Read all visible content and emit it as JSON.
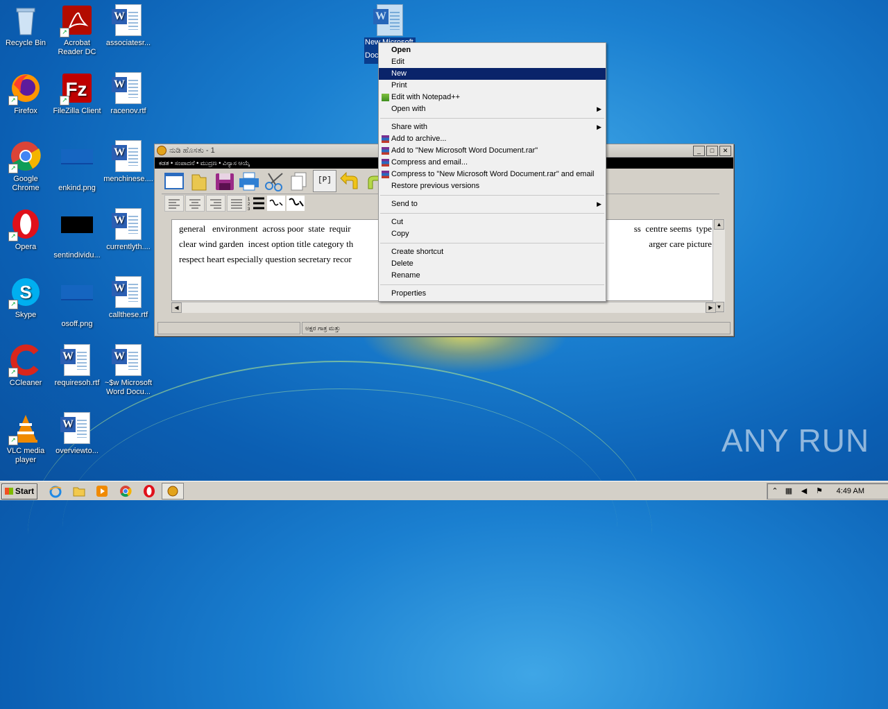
{
  "desktop": {
    "icons_col1": [
      {
        "label": "Recycle Bin",
        "icon": "recycle-bin-icon"
      },
      {
        "label": "Firefox",
        "icon": "firefox-icon"
      },
      {
        "label": "Google Chrome",
        "icon": "chrome-icon"
      },
      {
        "label": "Opera",
        "icon": "opera-icon"
      },
      {
        "label": "Skype",
        "icon": "skype-icon"
      },
      {
        "label": "CCleaner",
        "icon": "ccleaner-icon"
      },
      {
        "label": "VLC media player",
        "icon": "vlc-icon"
      }
    ],
    "icons_col2": [
      {
        "label": "Acrobat Reader DC",
        "icon": "acrobat-icon"
      },
      {
        "label": "FileZilla Client",
        "icon": "filezilla-icon"
      },
      {
        "label": "enkind.png",
        "icon": "image-file-icon"
      },
      {
        "label": "sentindividu...",
        "icon": "image-file-icon"
      },
      {
        "label": "osoff.png",
        "icon": "image-file-icon"
      },
      {
        "label": "requiresoh.rtf",
        "icon": "word-document-icon"
      },
      {
        "label": "overviewto...",
        "icon": "word-document-icon"
      }
    ],
    "icons_col3": [
      {
        "label": "associatesr...",
        "icon": "word-document-icon"
      },
      {
        "label": "racenov.rtf",
        "icon": "word-document-icon"
      },
      {
        "label": "menchinese....",
        "icon": "word-document-icon"
      },
      {
        "label": "currentlyth....",
        "icon": "word-document-icon"
      },
      {
        "label": "callthese.rtf",
        "icon": "word-document-icon"
      },
      {
        "label": "~$w Microsoft Word Docu...",
        "icon": "word-document-icon"
      }
    ],
    "selected_file": {
      "label_line1": "New Microsoft",
      "label_line2": "Doc",
      "icon": "word-document-icon"
    },
    "watermark": "ANY RUN"
  },
  "editor_window": {
    "title": "ನುಡಿ ಹೊಸತು - 1",
    "menu": "ಕಡತ • ಸಂಪಾದನೆ • ಮುದ್ರಣ • ವಿನ್ಯಾಸ ಆಯ್ಕೆ",
    "toolbar_icons": [
      "new-document-icon",
      "open-folder-icon",
      "save-icon",
      "print-icon",
      "cut-icon",
      "copy-icon",
      "paste-icon",
      "undo-icon",
      "redo-icon"
    ],
    "paste_label": "[P]",
    "format_icons": [
      "align-left-icon",
      "align-center-icon",
      "align-right-icon",
      "justify-icon",
      "numbered-list-icon",
      "font-small-icon",
      "font-large-icon"
    ],
    "content_lines": [
      "general   environment  across poor  state  requir",
      "clear wind garden  incest option title category th",
      "respect heart especially question secretary recor"
    ],
    "content_right": [
      "ss  centre seems  type",
      "arger care picture",
      ""
    ],
    "status_left": "",
    "status_right": "ಅಕ್ಷರ ಗಾತ್ರ ಮತ್ತು"
  },
  "context_menu": {
    "items": [
      {
        "label": "Open",
        "bold": true
      },
      {
        "label": "Edit"
      },
      {
        "label": "New",
        "highlighted": true
      },
      {
        "label": "Print"
      },
      {
        "label": "Edit with Notepad++",
        "icon": "notepad-plus-icon"
      },
      {
        "label": "Open with",
        "submenu": true
      },
      {
        "sep": true
      },
      {
        "label": "Share with",
        "submenu": true
      },
      {
        "label": "Add to archive...",
        "icon": "winrar-icon"
      },
      {
        "label": "Add to \"New Microsoft Word Document.rar\"",
        "icon": "winrar-icon"
      },
      {
        "label": "Compress and email...",
        "icon": "winrar-icon"
      },
      {
        "label": "Compress to \"New Microsoft Word Document.rar\" and email",
        "icon": "winrar-icon"
      },
      {
        "label": "Restore previous versions"
      },
      {
        "sep": true
      },
      {
        "label": "Send to",
        "submenu": true
      },
      {
        "sep": true
      },
      {
        "label": "Cut"
      },
      {
        "label": "Copy"
      },
      {
        "sep": true
      },
      {
        "label": "Create shortcut"
      },
      {
        "label": "Delete"
      },
      {
        "label": "Rename"
      },
      {
        "sep": true
      },
      {
        "label": "Properties"
      }
    ]
  },
  "taskbar": {
    "start_label": "Start",
    "pinned": [
      "ie-icon",
      "explorer-icon",
      "media-player-icon",
      "chrome-icon",
      "opera-icon",
      "nudi-app-icon"
    ],
    "clock": "4:49 AM",
    "tray_icons": [
      "show-hidden-icon",
      "network-icon",
      "volume-icon",
      "flag-icon"
    ]
  }
}
